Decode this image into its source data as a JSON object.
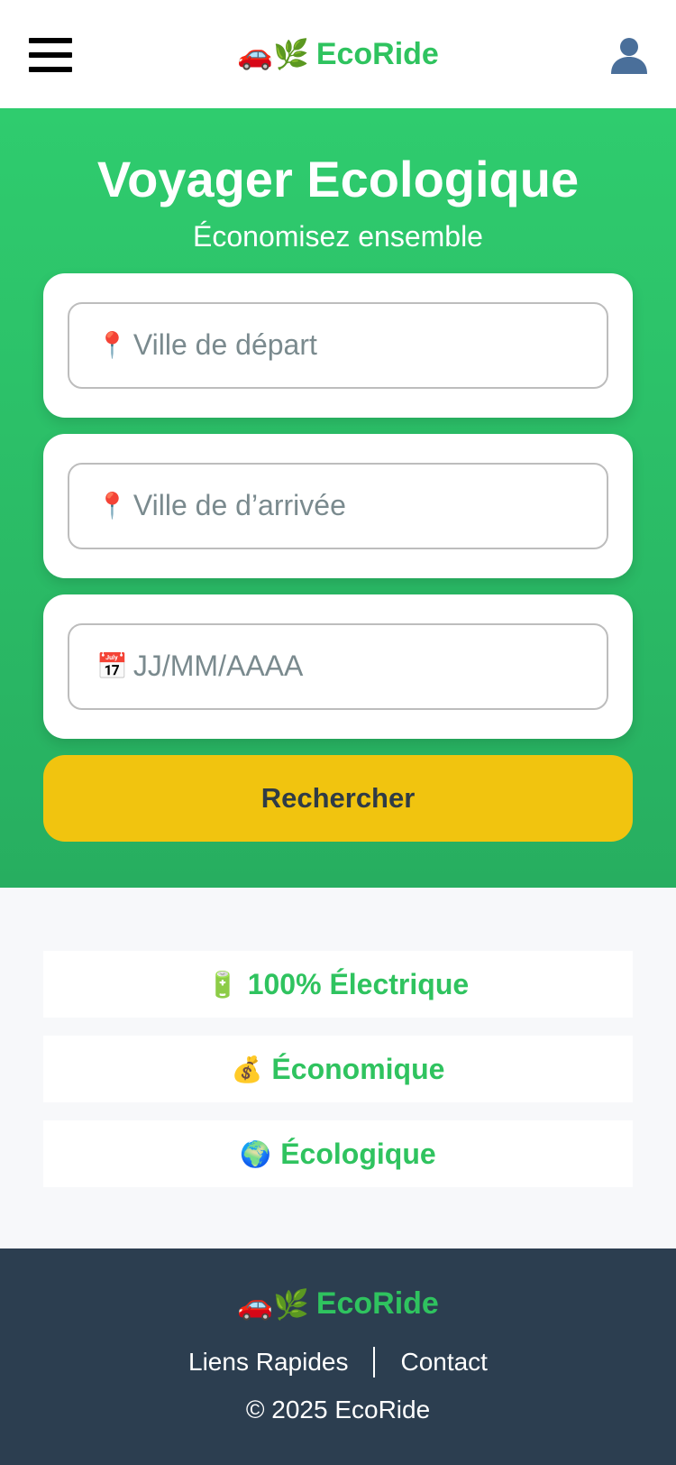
{
  "header": {
    "brand_emoji": "🚗🌿",
    "brand_name": "EcoRide"
  },
  "hero": {
    "title": "Voyager Ecologique",
    "subtitle": "Économisez ensemble",
    "departure": {
      "icon": "📍",
      "placeholder": "Ville de départ"
    },
    "arrival": {
      "icon": "📍",
      "placeholder": "Ville de d’arrivée"
    },
    "date": {
      "icon": "📅",
      "placeholder": "JJ/MM/AAAA"
    },
    "search_label": "Rechercher"
  },
  "features": [
    {
      "icon": "🔋",
      "label": "100% Électrique"
    },
    {
      "icon": "💰",
      "label": "Économique"
    },
    {
      "icon": "🌍",
      "label": "Écologique"
    }
  ],
  "footer": {
    "brand_emoji": "🚗🌿",
    "brand_name": "EcoRide",
    "links": [
      "Liens Rapides",
      "Contact"
    ],
    "copyright": "© 2025 EcoRide"
  },
  "colors": {
    "brand_green": "#2fc35f",
    "hero_green": "#27ae60",
    "button_yellow": "#f1c40f",
    "footer_bg": "#2c3e50"
  },
  "icons": {
    "menu": "hamburger-menu-icon",
    "user": "user-avatar-icon"
  }
}
